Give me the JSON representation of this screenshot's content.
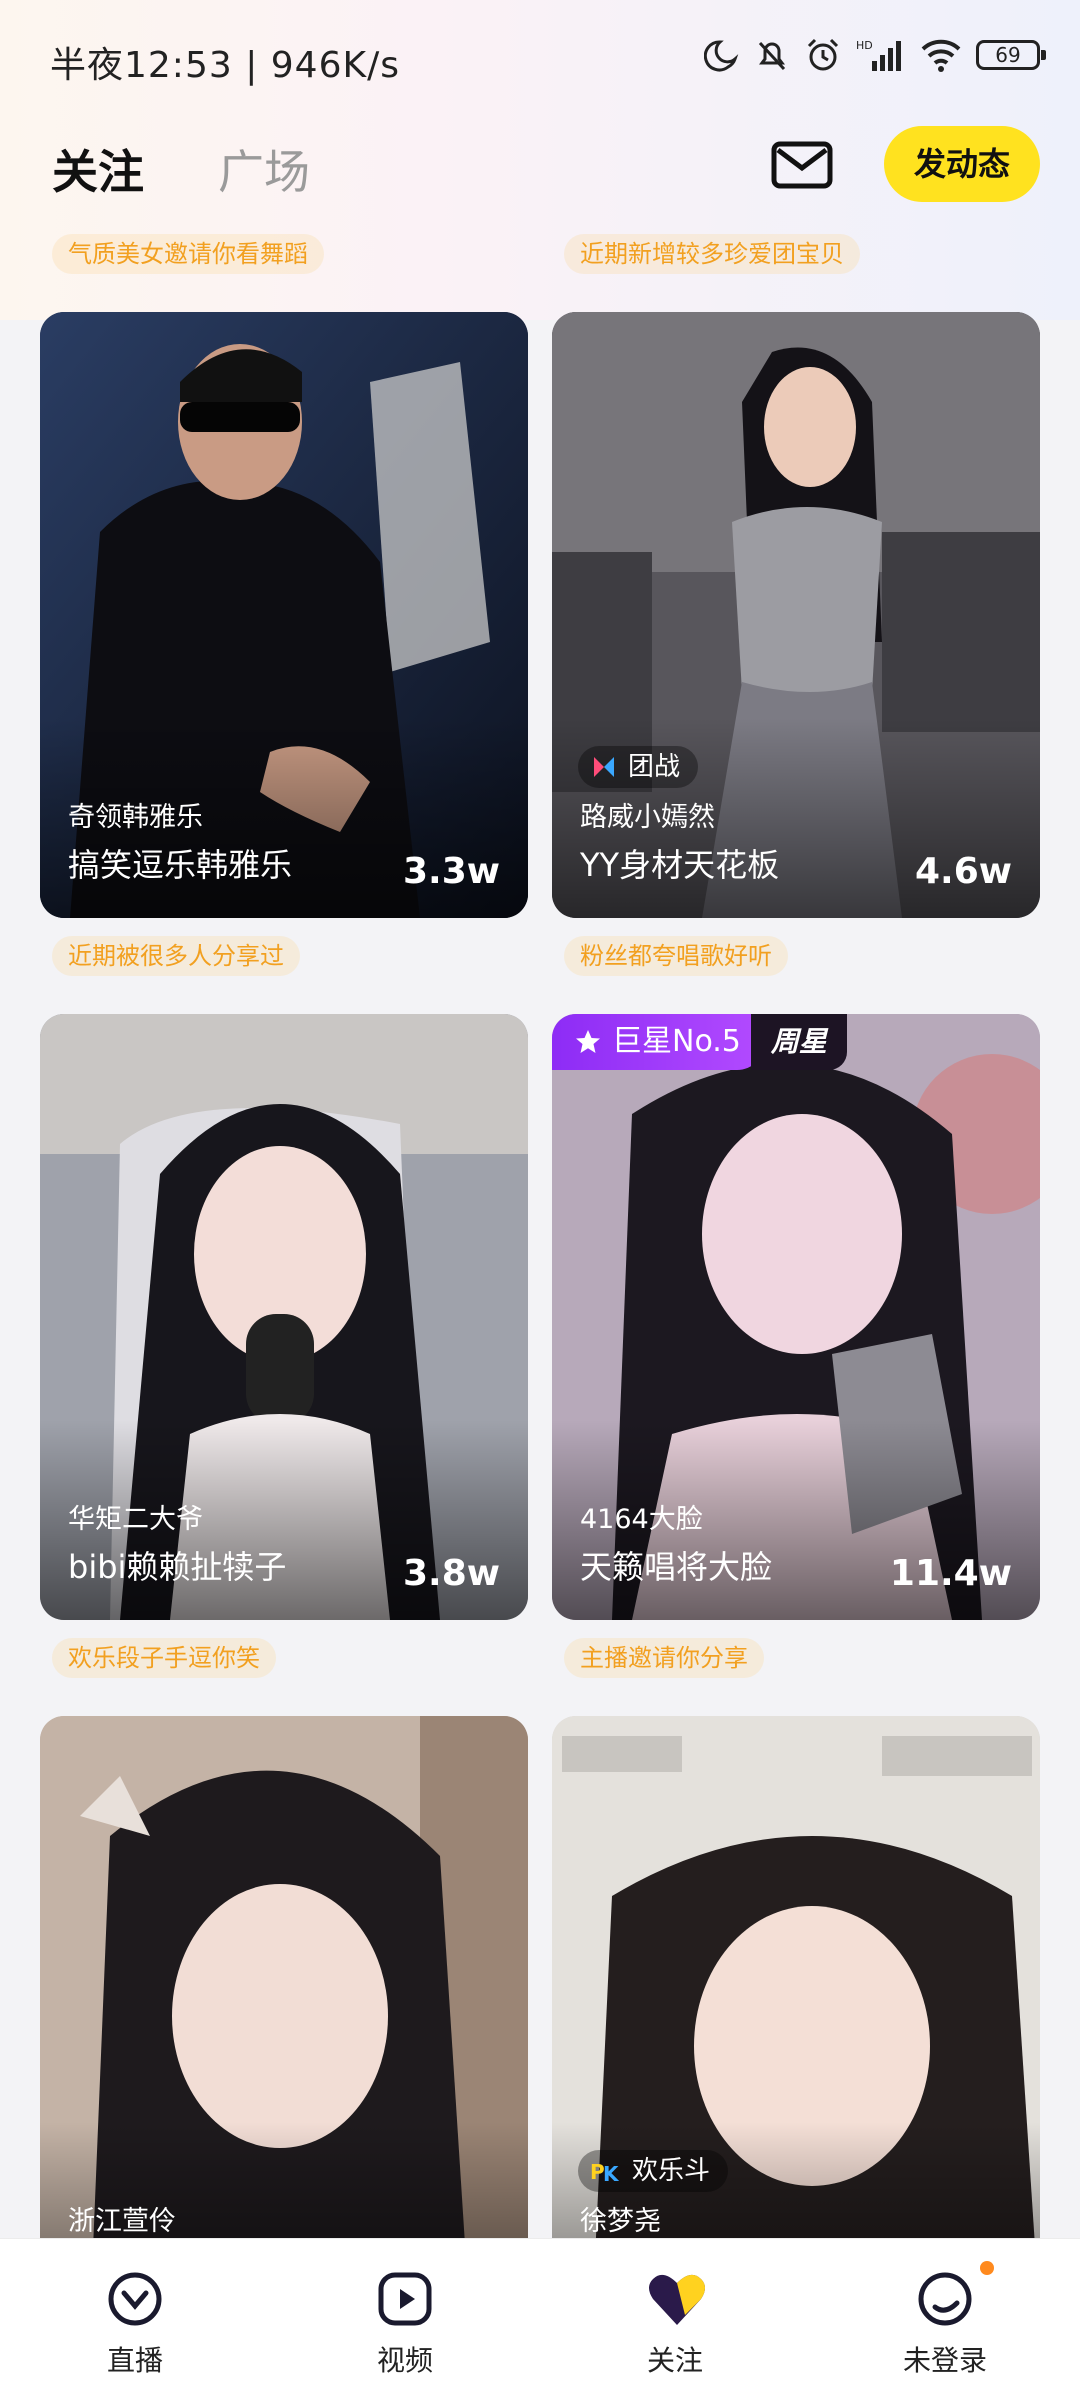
{
  "status_bar": {
    "time_text": "半夜12:53 | 946K/s",
    "battery": "69"
  },
  "header": {
    "tabs": [
      {
        "label": "关注",
        "active": true
      },
      {
        "label": "广场",
        "active": false
      }
    ],
    "post_button": "发动态"
  },
  "cards": [
    {
      "tag": "气质美女邀请你看舞蹈",
      "anchor": "奇领韩雅乐",
      "title": "搞笑逗乐韩雅乐",
      "count": "3.3w"
    },
    {
      "tag": "近期新增较多珍爱团宝贝",
      "badge": "团战",
      "anchor": "路威小嫣然",
      "title": "YY身材天花板",
      "count": "4.6w"
    },
    {
      "tag": "近期被很多人分享过",
      "anchor": "华矩二大爷",
      "title": "bibi赖赖扯犊子",
      "count": "3.8w"
    },
    {
      "tag": "粉丝都夸唱歌好听",
      "rank_label": "巨星No.5",
      "rank_period": "周星",
      "anchor": "4164大脸",
      "title": "天籁唱将大脸",
      "count": "11.4w"
    },
    {
      "tag": "欢乐段子手逗你笑",
      "anchor": "浙江萱伶"
    },
    {
      "tag": "主播邀请你分享",
      "badge": "欢乐斗",
      "anchor": "徐梦尧"
    }
  ],
  "bottom_nav": [
    {
      "label": "直播",
      "icon": "live-icon"
    },
    {
      "label": "视频",
      "icon": "video-icon"
    },
    {
      "label": "关注",
      "icon": "heart-icon",
      "active": true
    },
    {
      "label": "未登录",
      "icon": "profile-icon"
    }
  ],
  "colors": {
    "accent": "#ffe21f",
    "tag_text": "#f2a020",
    "rank_purple": "#8d2cf5",
    "notify_dot": "#ff8a1e"
  }
}
